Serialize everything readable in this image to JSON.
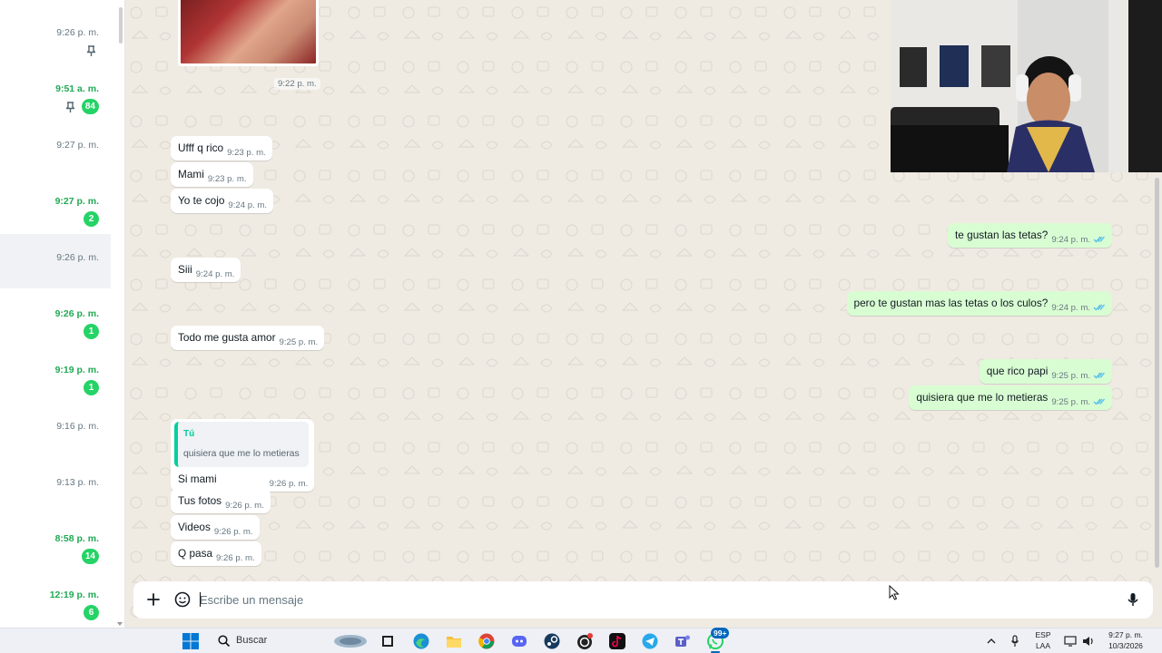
{
  "chat_list": {
    "items": [
      {
        "time": "9:26 p. m.",
        "unread": false,
        "badge": "",
        "pinned": true,
        "selected": false
      },
      {
        "time": "9:51 a. m.",
        "unread": true,
        "badge": "84",
        "pinned": true,
        "selected": false
      },
      {
        "time": "9:27 p. m.",
        "unread": false,
        "badge": "",
        "pinned": false,
        "selected": false
      },
      {
        "time": "9:27 p. m.",
        "unread": true,
        "badge": "2",
        "pinned": false,
        "selected": false
      },
      {
        "time": "9:26 p. m.",
        "unread": false,
        "badge": "",
        "pinned": false,
        "selected": true
      },
      {
        "time": "9:26 p. m.",
        "unread": true,
        "badge": "1",
        "pinned": false,
        "selected": false
      },
      {
        "time": "9:19 p. m.",
        "unread": true,
        "badge": "1",
        "pinned": false,
        "selected": false
      },
      {
        "time": "9:16 p. m.",
        "unread": false,
        "badge": "",
        "pinned": false,
        "selected": false
      },
      {
        "time": "9:13 p. m.",
        "unread": false,
        "badge": "",
        "pinned": false,
        "selected": false
      },
      {
        "time": "8:58 p. m.",
        "unread": true,
        "badge": "14",
        "pinned": false,
        "selected": false
      },
      {
        "time": "12:19 p. m.",
        "unread": true,
        "badge": "6",
        "pinned": false,
        "selected": false
      }
    ]
  },
  "conversation": {
    "media_time": "9:22 p. m.",
    "messages": [
      {
        "dir": "in",
        "text": "Ufff q rico",
        "time": "9:23 p. m."
      },
      {
        "dir": "in",
        "text": "Mami",
        "time": "9:23 p. m."
      },
      {
        "dir": "in",
        "text": "Yo te cojo",
        "time": "9:24 p. m."
      },
      {
        "dir": "out",
        "text": "te gustan las tetas?",
        "time": "9:24 p. m."
      },
      {
        "dir": "in",
        "text": "Siii",
        "time": "9:24 p. m."
      },
      {
        "dir": "out",
        "text": "pero te gustan mas las tetas o los culos?",
        "time": "9:24 p. m."
      },
      {
        "dir": "in",
        "text": "Todo me gusta amor",
        "time": "9:25 p. m."
      },
      {
        "dir": "out",
        "text": "que rico papi",
        "time": "9:25 p. m."
      },
      {
        "dir": "out",
        "text": "quisiera que me lo metieras",
        "time": "9:25 p. m."
      },
      {
        "dir": "in",
        "text": "Si mami",
        "time": "9:26 p. m.",
        "quote_author": "Tú",
        "quote_text": "quisiera que me lo metieras"
      },
      {
        "dir": "in",
        "text": "Tus fotos",
        "time": "9:26 p. m."
      },
      {
        "dir": "in",
        "text": "Videos",
        "time": "9:26 p. m."
      },
      {
        "dir": "in",
        "text": "Q pasa",
        "time": "9:26 p. m."
      }
    ]
  },
  "composer": {
    "placeholder": "Escribe un mensaje",
    "icons": [
      "plus-icon",
      "sticker-icon",
      "microphone-icon"
    ]
  },
  "taskbar": {
    "search_label": "Buscar",
    "notification_badge": "99+",
    "language": "ESP",
    "language_sub": "LAA",
    "clock_time": "9:27 p. m.",
    "clock_date": "10/3/2026"
  },
  "colors": {
    "accent_green": "#25d366",
    "unread_time": "#1faa53",
    "outgoing_bubble": "#d9fdd3",
    "incoming_bubble": "#ffffff",
    "chat_background": "#efeae2",
    "read_ticks": "#53bdeb"
  }
}
